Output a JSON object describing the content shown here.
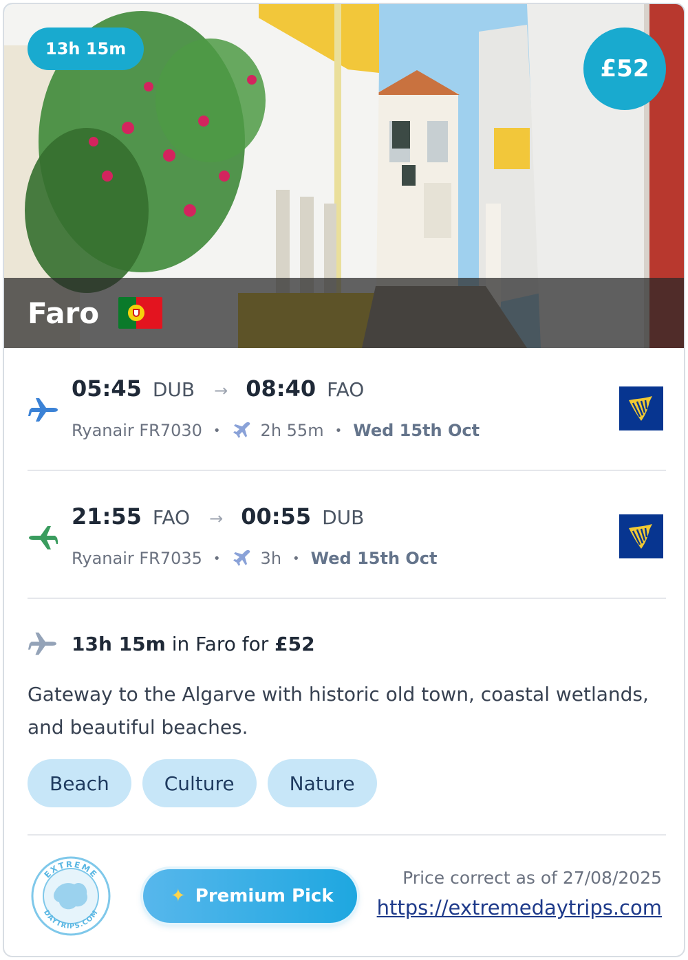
{
  "hero": {
    "duration_badge": "13h 15m",
    "price_badge": "£52",
    "city": "Faro"
  },
  "outbound": {
    "depart_time": "05:45",
    "depart_code": "DUB",
    "arrow": "→",
    "arrive_time": "08:40",
    "arrive_code": "FAO",
    "airline_flight": "Ryanair FR7030",
    "duration": "2h 55m",
    "date": "Wed 15th Oct",
    "separator": "•"
  },
  "return": {
    "depart_time": "21:55",
    "depart_code": "FAO",
    "arrow": "→",
    "arrive_time": "00:55",
    "arrive_code": "DUB",
    "airline_flight": "Ryanair FR7035",
    "duration": "3h",
    "date": "Wed 15th Oct",
    "separator": "•"
  },
  "summary": {
    "duration": "13h 15m",
    "middle": " in Faro for ",
    "price": "£52"
  },
  "description": "Gateway to the Algarve with historic old town, coastal wetlands, and beautiful beaches.",
  "tags": [
    "Beach",
    "Culture",
    "Nature"
  ],
  "footer": {
    "premium_label": "Premium Pick",
    "price_note": "Price correct as of 27/08/2025",
    "link": "https://extremedaytrips.com",
    "stamp_text_top": "EXTREME",
    "stamp_text_bottom": "DAYTRIPS.COM"
  },
  "colors": {
    "accent": "#19aacf",
    "outbound_icon": "#3b82d6",
    "return_icon": "#3a9c5e",
    "ryanair_blue": "#073590",
    "ryanair_yellow": "#f1c933",
    "tag_bg": "#c7e6f8"
  },
  "icons": {
    "outbound": "plane-takeoff-icon",
    "return": "plane-landing-icon",
    "duration": "flight-icon",
    "summary": "plane-icon"
  }
}
